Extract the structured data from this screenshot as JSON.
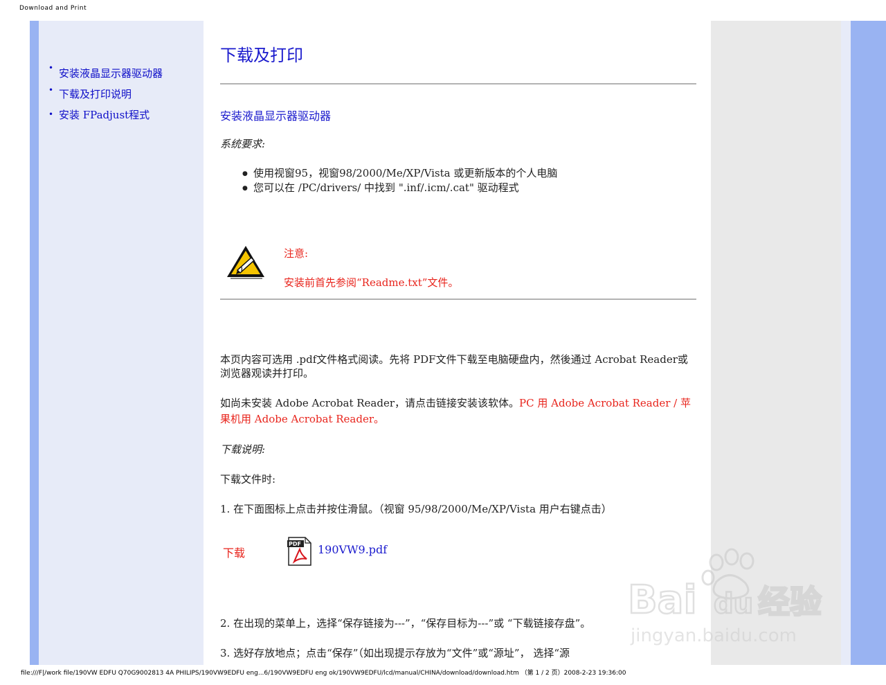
{
  "print_header": "Download and Print",
  "print_footer": "file:///F|/work file/190VW EDFU Q70G9002813 4A PHILIPS/190VW9EDFU eng...6/190VW9EDFU eng ok/190VW9EDFU/lcd/manual/CHINA/download/download.htm （第 1 / 2 页）2008-2-23 19:36:00",
  "sidebar": {
    "items": [
      {
        "label": "安装液晶显示器驱动器"
      },
      {
        "label": "下载及打印说明"
      },
      {
        "label": "安装 FPadjust程式"
      }
    ]
  },
  "main": {
    "title": "下载及打印",
    "section_title": "安装液晶显示器驱动器",
    "requirements_title": "系统要求:",
    "requirements": [
      "使用视窗95，视窗98/2000/Me/XP/Vista 或更新版本的个人电脑",
      "您可以在 /PC/drivers/ 中找到 \".inf/.icm/.cat\" 驱动程式"
    ],
    "note_title": "注意:",
    "note_text": "安装前首先参阅“Readme.txt”文件。",
    "para1": "本页内容可选用 .pdf文件格式阅读。先将 PDF文件下载至电脑硬盘内，然後通过 Acrobat Reader或浏览器观读并打印。",
    "para2_prefix": "如尚未安装 Adobe   Acrobat Reader，请点击链接安装该软体。",
    "link_pc": "PC 用 Adobe   Acrobat Reader",
    "link_sep": " / ",
    "link_mac": "苹果机用 Adobe   Acrobat Reader。",
    "download_title": "下载说明:",
    "download_when": "下载文件时:",
    "step1": "1. 在下面图标上点击并按住滑鼠。（视窗 95/98/2000/Me/XP/Vista 用户右键点击）",
    "download_label": "下载",
    "pdf_filename": "190VW9.pdf",
    "step2": "2. 在出现的菜单上，选择“保存链接为---”，“保存目标为---”或 “下载链接存盘”。",
    "step3": "3. 选好存放地点；点击“保存”（如出现提示存放为“文件”或“源址”， 选择“源"
  },
  "watermark": {
    "brand": "Bai",
    "brand2": "du",
    "cn": "经验",
    "url": "jingyan.baidu.com"
  },
  "colors": {
    "band_blue": "#99b3f2",
    "sidebar_bg": "#e7ebf8",
    "link_blue": "#1a1acd",
    "warn_red": "#e8241c"
  }
}
